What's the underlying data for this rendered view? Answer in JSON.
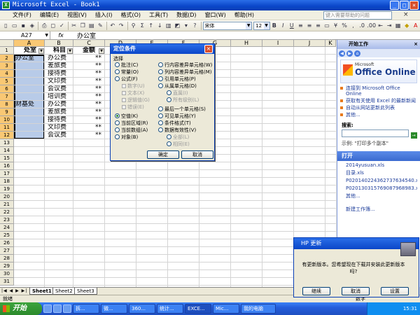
{
  "window": {
    "title": "Microsoft Excel - Book1",
    "app_icon": "X"
  },
  "menu": [
    "文件(F)",
    "编辑(E)",
    "视图(V)",
    "插入(I)",
    "格式(O)",
    "工具(T)",
    "数据(D)",
    "窗口(W)",
    "帮助(H)"
  ],
  "help_placeholder": "键入需要帮助的问题",
  "toolbar": {
    "font": "宋体",
    "size": "12"
  },
  "formula_bar": {
    "name_box": "A27",
    "fx": "fx",
    "content": "办公室"
  },
  "columns": [
    "A",
    "B",
    "C",
    "D",
    "E",
    "F",
    "G",
    "H",
    "I",
    "J",
    "K"
  ],
  "rows": [
    "1",
    "2",
    "3",
    "4",
    "5",
    "6",
    "7",
    "8",
    "9",
    "10",
    "11",
    "12",
    "13",
    "14",
    "15",
    "16",
    "17",
    "18",
    "19",
    "20",
    "21",
    "22",
    "23",
    "24",
    "25",
    "26",
    "27",
    "28",
    "29",
    "30",
    "31"
  ],
  "headers": {
    "a1": "处室",
    "b1": "科目",
    "c1": "金额"
  },
  "cells": {
    "a2": "办公室",
    "a8": "财基处",
    "b": [
      "办公费",
      "差旅费",
      "接待费",
      "文印费",
      "会议费",
      "培训费",
      "办公费",
      "差旅费",
      "接待费",
      "文印费",
      "会议费"
    ],
    "c": [
      "**",
      "**",
      "**",
      "**",
      "**",
      "**",
      "**",
      "**",
      "**",
      "**",
      "**"
    ]
  },
  "goto_dialog": {
    "title": "定位条件",
    "section": "选择",
    "left_options": [
      "批注(C)",
      "常量(O)",
      "公式(F)",
      "数字(U)",
      "文本(X)",
      "逻辑值(G)",
      "错误(E)",
      "空值(K)",
      "当前区域(R)",
      "当前数组(A)",
      "对象(B)"
    ],
    "right_options": [
      "行内容差异单元格(W)",
      "列内容差异单元格(M)",
      "引用单元格(P)",
      "从属单元格(D)",
      "直属(I)",
      "所有级别(L)",
      "最后一个单元格(S)",
      "可见单元格(Y)",
      "条件格式(T)",
      "数据有效性(V)",
      "全部(L)",
      "相同(E)"
    ],
    "selected": "空值(K)",
    "ok": "确定",
    "cancel": "取消"
  },
  "task_pane": {
    "title": "开始工作",
    "banner_small": "Microsoft",
    "banner_big": "Office Online",
    "links": [
      "连接到 Microsoft Office Online",
      "获取有关使用 Excel 的最新新闻",
      "自动从网站更新此列表"
    ],
    "more": "其他...",
    "search_label": "搜索:",
    "example": "示例: \"打印多个副本\"",
    "open_title": "打开",
    "files": [
      "2014yusuan.xls",
      "目录.xls",
      "P020140224362737634540.xls",
      "P020130315769087968983.xls"
    ],
    "files_more": "其他...",
    "new_workbook": "新建工作簿..."
  },
  "sheet_tabs": [
    "Sheet1",
    "Sheet2",
    "Sheet3"
  ],
  "status": {
    "left": "就绪",
    "right": "数字"
  },
  "hp_dialog": {
    "title": "HP 更新",
    "message": "有更新版本。您希望现在下载并安装此更新版本吗?",
    "buttons": [
      "继续",
      "取消",
      "设置"
    ]
  },
  "taskbar": {
    "start": "开始",
    "tasks": [
      "拆...",
      "微...",
      "360...",
      "统计...",
      "EXCE...",
      "Mic...",
      "我的电脑"
    ],
    "time": "15:31"
  }
}
